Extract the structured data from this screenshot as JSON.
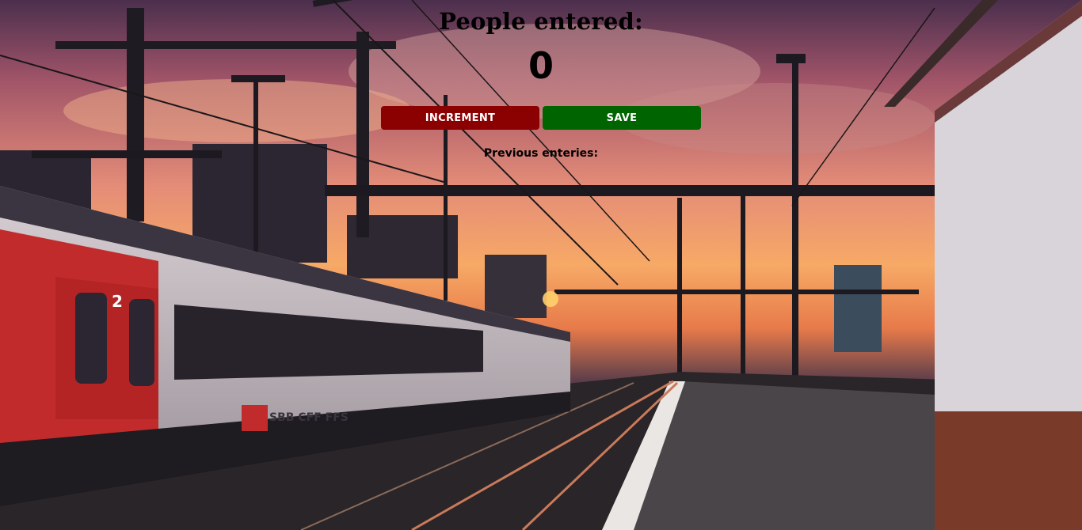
{
  "counter": {
    "heading": "People entered:",
    "count": "0"
  },
  "buttons": {
    "increment_label": "INCREMENT",
    "save_label": "SAVE"
  },
  "previous": {
    "label": "Previous enteries:",
    "entries": []
  },
  "background": {
    "description_colors": {
      "sky_top": "#3d2a47",
      "sky_glow": "#f3a064",
      "increment": "#8b0000",
      "save": "#006400"
    },
    "train_logo_text": "SBB CFF FFS",
    "train_car_number": "2"
  }
}
